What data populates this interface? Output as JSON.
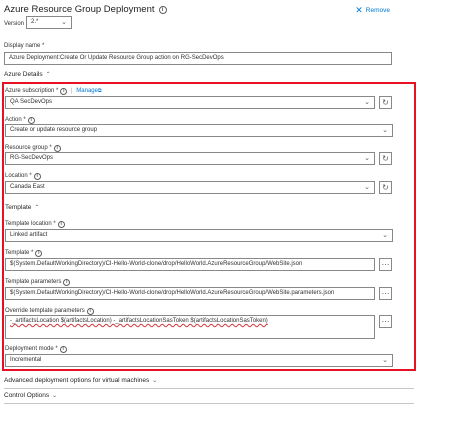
{
  "header": {
    "title": "Azure Resource Group Deployment",
    "remove_label": "Remove"
  },
  "version": {
    "label": "Version",
    "value": "2.*"
  },
  "display_name": {
    "label": "Display name *",
    "value": "Azure Deployment:Create Or Update Resource Group action on RG-SecDevOps"
  },
  "azure_details": {
    "heading": "Azure Details",
    "subscription": {
      "label": "Azure subscription *",
      "manage": "Manage",
      "value": "QA SecDevOps"
    },
    "action": {
      "label": "Action *",
      "value": "Create or update resource group"
    },
    "resource_group": {
      "label": "Resource group *",
      "value": "RG-SecDevOps"
    },
    "location": {
      "label": "Location *",
      "value": "Canada East"
    }
  },
  "template_section": {
    "heading": "Template",
    "template_location": {
      "label": "Template location *",
      "value": "Linked artifact"
    },
    "template": {
      "label": "Template *",
      "value": "$(System.DefaultWorkingDirectory)/CI-Hello-World-clone/drop/HelloWorld.AzureResourceGroup/WebSite.json"
    },
    "template_parameters": {
      "label": "Template parameters",
      "value": "$(System.DefaultWorkingDirectory)/CI-Hello-World-clone/drop/HelloWorld.AzureResourceGroup/WebSite.parameters.json"
    },
    "override": {
      "label": "Override template parameters",
      "value": "-_artifactsLocation $(artifactsLocation) -_artifactsLocationSasToken $(artifactsLocationSasToken)"
    },
    "deployment_mode": {
      "label": "Deployment mode *",
      "value": "Incremental"
    }
  },
  "advanced": {
    "label": "Advanced deployment options for virtual machines"
  },
  "control_options": {
    "label": "Control Options"
  },
  "icons": {
    "info": "info-icon",
    "refresh": "refresh-icon",
    "chevron": "chevron-down-icon",
    "ellipsis": "ellipsis-icon",
    "close": "close-icon",
    "external": "external-link-icon"
  },
  "colors": {
    "accent": "#0078d4",
    "highlight_border": "#e81123"
  }
}
